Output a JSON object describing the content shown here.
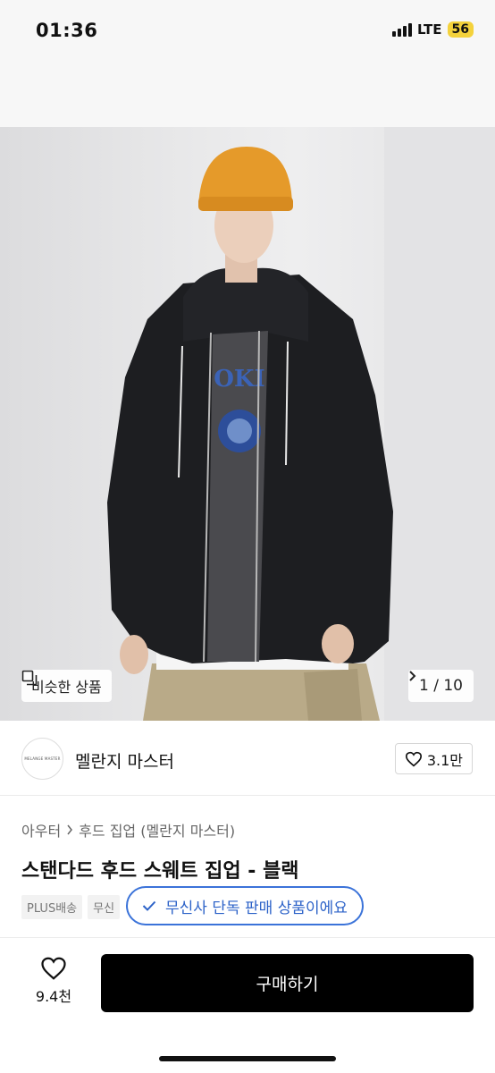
{
  "status_bar": {
    "time": "01:36",
    "network": "LTE",
    "battery": "56"
  },
  "hero": {
    "similar_label": "비슷한 상품",
    "page_indicator": "1 / 10",
    "shirt_print": "OKI"
  },
  "brand": {
    "name": "멜란지 마스터",
    "logo_text": "MELANGE MASTER",
    "likes": "3.1만"
  },
  "breadcrumb": {
    "level1": "아우터",
    "level2": "후드 집업 (멜란지 마스터)"
  },
  "product": {
    "title": "스탠다드 후드 스웨트 집업 - 블랙"
  },
  "tags": [
    "PLUS배송",
    "무신"
  ],
  "exclusive": {
    "label": "무신사 단독 판매 상품이에요"
  },
  "bottom_bar": {
    "wish_count": "9.4천",
    "buy_label": "구매하기"
  },
  "colors": {
    "accent_blue": "#2c62c8",
    "buy_button": "#000000",
    "battery": "#f4d23c"
  },
  "icons": [
    "signal-icon",
    "copy-icon",
    "chevron-right-icon",
    "heart-icon",
    "check-icon"
  ]
}
